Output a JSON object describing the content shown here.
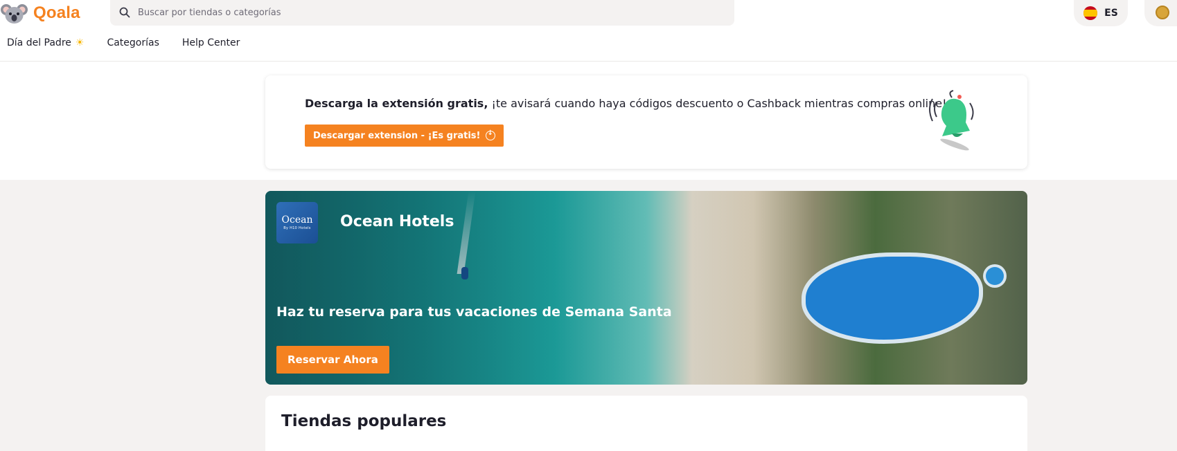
{
  "header": {
    "logo_text": "Qoala",
    "search_placeholder": "Buscar por tiendas o categorías",
    "language": "ES"
  },
  "nav": {
    "items": [
      {
        "label": "Día del Padre",
        "icon": "sun-icon"
      },
      {
        "label": "Categorías"
      },
      {
        "label": "Help Center"
      }
    ]
  },
  "extension_banner": {
    "bold_text": "Descarga la extensión gratis,",
    "text": " ¡te avisará cuando haya códigos descuento o Cashback mientras compras online!",
    "button_label": "Descargar extension - ¡Es gratis!",
    "illustration": "bell-icon"
  },
  "hero": {
    "brand_logo_text": "Ocean",
    "brand_logo_subtext": "By H10 Hotels",
    "brand_name": "Ocean Hotels",
    "tagline": "Haz tu reserva para tus vacaciones de Semana Santa",
    "button_label": "Reservar Ahora"
  },
  "popular": {
    "title": "Tiendas populares"
  },
  "colors": {
    "accent": "#f58220",
    "background": "#f4f2f1",
    "text": "#1e1e2a"
  }
}
